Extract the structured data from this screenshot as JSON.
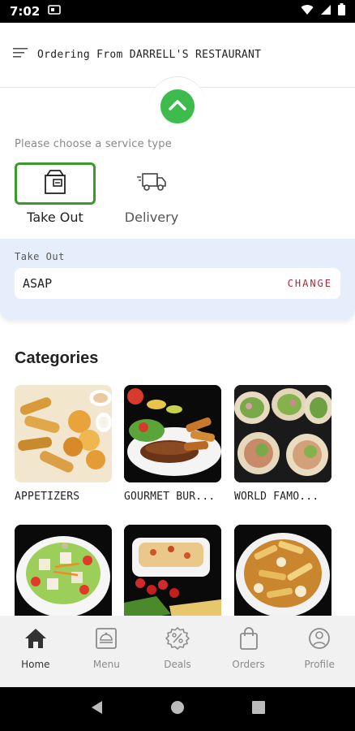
{
  "status_bar": {
    "time": "7:02",
    "icons": [
      "sim-card-icon",
      "wifi-icon",
      "cellular-signal-icon",
      "battery-icon"
    ]
  },
  "header": {
    "menu_icon": "menu-icon",
    "title": "Ordering From DARRELL'S RESTAURANT"
  },
  "collapse": {
    "icon": "chevron-up-icon",
    "color": "#3dbb4c"
  },
  "service": {
    "prompt": "Please choose a service type",
    "options": [
      {
        "label": "Take Out",
        "icon": "takeout-bag-icon",
        "selected": true
      },
      {
        "label": "Delivery",
        "icon": "delivery-truck-icon",
        "selected": false
      }
    ],
    "selected_border_color": "#3a9a2b"
  },
  "order_panel": {
    "label": "Take Out",
    "time_value": "ASAP",
    "change_label": "CHANGE",
    "change_color": "#a62a36",
    "background": "#e7eefb"
  },
  "categories": {
    "title": "Categories",
    "items": [
      {
        "label": "APPETIZERS"
      },
      {
        "label": "GOURMET BUR..."
      },
      {
        "label": "WORLD FAMO..."
      },
      {
        "label": ""
      },
      {
        "label": ""
      },
      {
        "label": ""
      }
    ]
  },
  "bottom_nav": {
    "items": [
      {
        "label": "Home",
        "icon": "home-icon",
        "active": true
      },
      {
        "label": "Menu",
        "icon": "menu-book-icon",
        "active": false
      },
      {
        "label": "Deals",
        "icon": "discount-badge-icon",
        "active": false
      },
      {
        "label": "Orders",
        "icon": "shopping-bag-icon",
        "active": false
      },
      {
        "label": "Profile",
        "icon": "user-profile-icon",
        "active": false
      }
    ]
  },
  "system_nav": [
    "back-icon",
    "home-circle-icon",
    "recents-icon"
  ]
}
